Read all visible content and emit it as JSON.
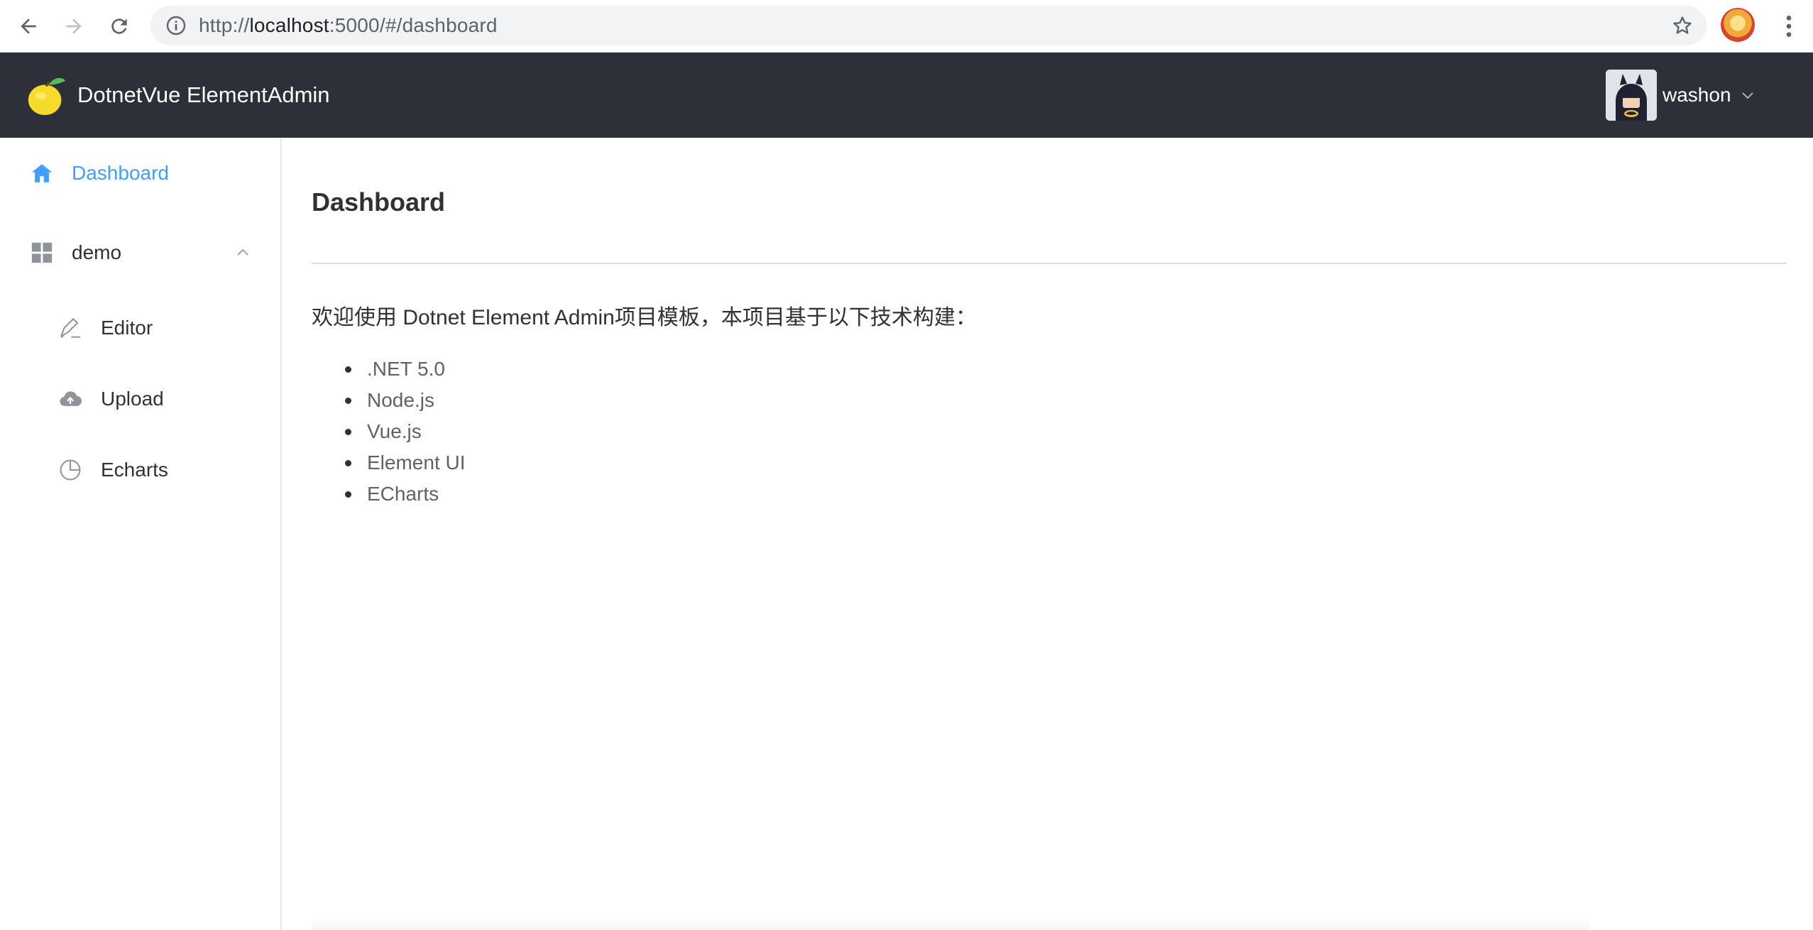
{
  "browser": {
    "url_prefix": "http://",
    "url_host": "localhost",
    "url_rest": ":5000/#/dashboard"
  },
  "header": {
    "title": "DotnetVue ElementAdmin",
    "username": "washon"
  },
  "sidebar": {
    "items": [
      {
        "label": "Dashboard",
        "icon": "home-icon",
        "active": true
      },
      {
        "label": "demo",
        "icon": "grid-icon",
        "expanded": true
      },
      {
        "label": "Editor",
        "icon": "edit-icon"
      },
      {
        "label": "Upload",
        "icon": "upload-cloud-icon"
      },
      {
        "label": "Echarts",
        "icon": "pie-chart-icon"
      }
    ]
  },
  "main": {
    "title": "Dashboard",
    "intro": "欢迎使用 Dotnet Element Admin项目模板，本项目基于以下技术构建：",
    "tech": [
      ".NET 5.0",
      "Node.js",
      "Vue.js",
      "Element UI",
      "ECharts"
    ]
  },
  "colors": {
    "header_bg": "#2d3039",
    "accent": "#409eff"
  }
}
